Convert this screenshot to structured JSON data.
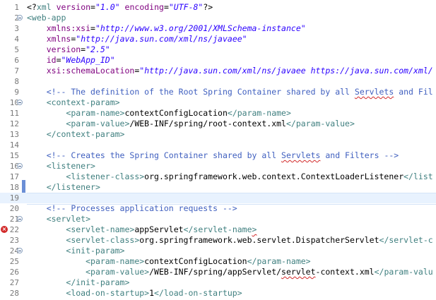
{
  "editor": {
    "file_type": "web.xml",
    "error_line": 22,
    "current_line": 19,
    "lines": [
      {
        "n": "1",
        "fold": false,
        "segs": [
          [
            "pi",
            "<?"
          ],
          [
            "tag",
            "xml"
          ],
          [
            "text",
            " "
          ],
          [
            "attr",
            "version"
          ],
          [
            "text",
            "="
          ],
          [
            "val",
            "\"1.0\""
          ],
          [
            "text",
            " "
          ],
          [
            "attr",
            "encoding"
          ],
          [
            "text",
            "="
          ],
          [
            "val",
            "\"UTF-8\""
          ],
          [
            "pi",
            "?>"
          ]
        ]
      },
      {
        "n": "2",
        "fold": true,
        "segs": [
          [
            "tag",
            "<web-app"
          ]
        ]
      },
      {
        "n": "3",
        "fold": false,
        "segs": [
          [
            "text",
            "    "
          ],
          [
            "attr",
            "xmlns:xsi"
          ],
          [
            "text",
            "="
          ],
          [
            "val",
            "\"http://www.w3.org/2001/XMLSchema-instance\""
          ]
        ]
      },
      {
        "n": "4",
        "fold": false,
        "segs": [
          [
            "text",
            "    "
          ],
          [
            "attr",
            "xmlns"
          ],
          [
            "text",
            "="
          ],
          [
            "val",
            "\"http://java.sun.com/xml/ns/javaee\""
          ]
        ]
      },
      {
        "n": "5",
        "fold": false,
        "segs": [
          [
            "text",
            "    "
          ],
          [
            "attr",
            "version"
          ],
          [
            "text",
            "="
          ],
          [
            "val",
            "\"2.5\""
          ]
        ]
      },
      {
        "n": "6",
        "fold": false,
        "segs": [
          [
            "text",
            "    "
          ],
          [
            "attr",
            "id"
          ],
          [
            "text",
            "="
          ],
          [
            "val",
            "\"WebApp_ID\""
          ]
        ]
      },
      {
        "n": "7",
        "fold": false,
        "segs": [
          [
            "text",
            "    "
          ],
          [
            "attr",
            "xsi:schemaLocation"
          ],
          [
            "text",
            "="
          ],
          [
            "val",
            "\"http://java.sun.com/xml/ns/javaee https://java.sun.com/xml/"
          ]
        ]
      },
      {
        "n": "8",
        "fold": false,
        "segs": []
      },
      {
        "n": "9",
        "fold": false,
        "segs": [
          [
            "text",
            "    "
          ],
          [
            "comment",
            "<!-- The definition of the Root Spring Container shared by all "
          ],
          [
            "comment-squig",
            "Servlets"
          ],
          [
            "comment",
            " and Fil"
          ]
        ]
      },
      {
        "n": "10",
        "fold": true,
        "segs": [
          [
            "text",
            "    "
          ],
          [
            "tag",
            "<context-param>"
          ]
        ]
      },
      {
        "n": "11",
        "fold": false,
        "segs": [
          [
            "text",
            "        "
          ],
          [
            "tag",
            "<param-name>"
          ],
          [
            "text",
            "contextConfigLocation"
          ],
          [
            "tag",
            "</param-name>"
          ]
        ]
      },
      {
        "n": "12",
        "fold": false,
        "segs": [
          [
            "text",
            "        "
          ],
          [
            "tag",
            "<param-value>"
          ],
          [
            "text",
            "/WEB-INF/spring/root-context.xml"
          ],
          [
            "tag",
            "</param-value>"
          ]
        ]
      },
      {
        "n": "13",
        "fold": false,
        "segs": [
          [
            "text",
            "    "
          ],
          [
            "tag",
            "</context-param>"
          ]
        ]
      },
      {
        "n": "14",
        "fold": false,
        "segs": []
      },
      {
        "n": "15",
        "fold": false,
        "segs": [
          [
            "text",
            "    "
          ],
          [
            "comment",
            "<!-- Creates the Spring Container shared by all "
          ],
          [
            "comment-squig",
            "Servlets"
          ],
          [
            "comment",
            " and Filters -->"
          ]
        ]
      },
      {
        "n": "16",
        "fold": true,
        "segs": [
          [
            "text",
            "    "
          ],
          [
            "tag",
            "<listener>"
          ]
        ]
      },
      {
        "n": "17",
        "fold": false,
        "segs": [
          [
            "text",
            "        "
          ],
          [
            "tag",
            "<listener-class>"
          ],
          [
            "text",
            "org.springframework.web.context.ContextLoaderListener"
          ],
          [
            "tag",
            "</list"
          ]
        ]
      },
      {
        "n": "18",
        "fold": false,
        "segs": [
          [
            "text",
            "    "
          ],
          [
            "tag",
            "</listener>"
          ]
        ]
      },
      {
        "n": "19",
        "fold": false,
        "segs": []
      },
      {
        "n": "20",
        "fold": false,
        "segs": [
          [
            "text",
            "    "
          ],
          [
            "comment",
            "<!-- Processes application requests -->"
          ]
        ]
      },
      {
        "n": "21",
        "fold": true,
        "segs": [
          [
            "text",
            "    "
          ],
          [
            "tag",
            "<servlet>"
          ]
        ]
      },
      {
        "n": "22",
        "fold": false,
        "segs": [
          [
            "text",
            "        "
          ],
          [
            "tag",
            "<servlet-name>"
          ],
          [
            "text",
            "appServlet"
          ],
          [
            "tag",
            "</servlet-name"
          ],
          [
            "tag-squig",
            ">"
          ]
        ]
      },
      {
        "n": "23",
        "fold": false,
        "segs": [
          [
            "text",
            "        "
          ],
          [
            "tag",
            "<servlet-class>"
          ],
          [
            "text",
            "org.springframework.web.servlet.DispatcherServlet"
          ],
          [
            "tag",
            "</servlet-c"
          ]
        ]
      },
      {
        "n": "24",
        "fold": true,
        "segs": [
          [
            "text",
            "        "
          ],
          [
            "tag",
            "<init-param>"
          ]
        ]
      },
      {
        "n": "25",
        "fold": false,
        "segs": [
          [
            "text",
            "            "
          ],
          [
            "tag",
            "<param-name>"
          ],
          [
            "text",
            "contextConfigLocation"
          ],
          [
            "tag",
            "</param-name>"
          ]
        ]
      },
      {
        "n": "26",
        "fold": false,
        "segs": [
          [
            "text",
            "            "
          ],
          [
            "tag",
            "<param-value>"
          ],
          [
            "text",
            "/WEB-INF/spring/appServlet/"
          ],
          [
            "text-squig",
            "servlet"
          ],
          [
            "text",
            "-context.xml"
          ],
          [
            "tag",
            "</param-valu"
          ]
        ]
      },
      {
        "n": "27",
        "fold": false,
        "segs": [
          [
            "text",
            "        "
          ],
          [
            "tag",
            "</init-param>"
          ]
        ]
      },
      {
        "n": "28",
        "fold": false,
        "segs": [
          [
            "text",
            "        "
          ],
          [
            "tag",
            "<load-on-startup>"
          ],
          [
            "text",
            "1"
          ],
          [
            "tag",
            "</load-on-startup>"
          ]
        ]
      }
    ],
    "colors": {
      "tag": "#3f7f7f",
      "attr": "#7f007f",
      "value": "#2a00ff",
      "comment": "#3f5fbf",
      "current_line": "#e8f2fe",
      "change_bar": "#6b8fd6",
      "error": "#d22a2a"
    }
  }
}
